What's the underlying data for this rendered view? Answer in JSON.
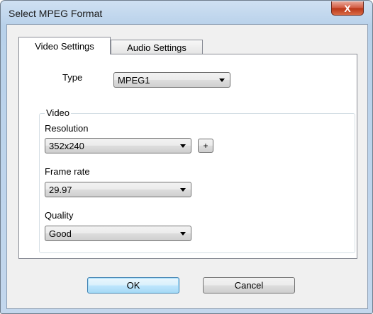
{
  "window": {
    "title": "Select MPEG Format",
    "close_label": "X"
  },
  "tabs": [
    {
      "label": "Video Settings",
      "active": true
    },
    {
      "label": "Audio Settings",
      "active": false
    }
  ],
  "video_settings": {
    "type_label": "Type",
    "type_value": "MPEG1",
    "group_label": "Video",
    "resolution_label": "Resolution",
    "resolution_value": "352x240",
    "resolution_add_label": "+",
    "frame_rate_label": "Frame rate",
    "frame_rate_value": "29.97",
    "quality_label": "Quality",
    "quality_value": "Good"
  },
  "buttons": {
    "ok": "OK",
    "cancel": "Cancel"
  }
}
